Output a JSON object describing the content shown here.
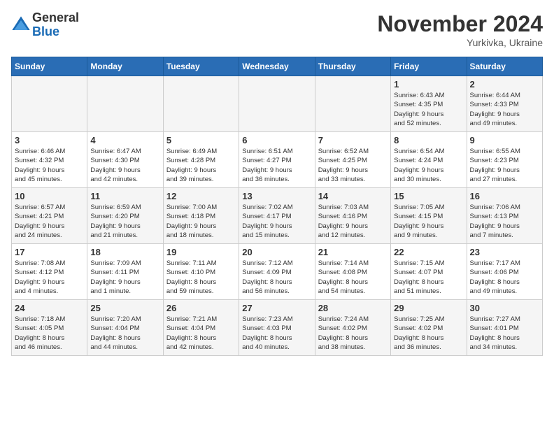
{
  "logo": {
    "general": "General",
    "blue": "Blue"
  },
  "title": "November 2024",
  "location": "Yurkivka, Ukraine",
  "days_of_week": [
    "Sunday",
    "Monday",
    "Tuesday",
    "Wednesday",
    "Thursday",
    "Friday",
    "Saturday"
  ],
  "weeks": [
    [
      {
        "day": "",
        "info": ""
      },
      {
        "day": "",
        "info": ""
      },
      {
        "day": "",
        "info": ""
      },
      {
        "day": "",
        "info": ""
      },
      {
        "day": "",
        "info": ""
      },
      {
        "day": "1",
        "info": "Sunrise: 6:43 AM\nSunset: 4:35 PM\nDaylight: 9 hours\nand 52 minutes."
      },
      {
        "day": "2",
        "info": "Sunrise: 6:44 AM\nSunset: 4:33 PM\nDaylight: 9 hours\nand 49 minutes."
      }
    ],
    [
      {
        "day": "3",
        "info": "Sunrise: 6:46 AM\nSunset: 4:32 PM\nDaylight: 9 hours\nand 45 minutes."
      },
      {
        "day": "4",
        "info": "Sunrise: 6:47 AM\nSunset: 4:30 PM\nDaylight: 9 hours\nand 42 minutes."
      },
      {
        "day": "5",
        "info": "Sunrise: 6:49 AM\nSunset: 4:28 PM\nDaylight: 9 hours\nand 39 minutes."
      },
      {
        "day": "6",
        "info": "Sunrise: 6:51 AM\nSunset: 4:27 PM\nDaylight: 9 hours\nand 36 minutes."
      },
      {
        "day": "7",
        "info": "Sunrise: 6:52 AM\nSunset: 4:25 PM\nDaylight: 9 hours\nand 33 minutes."
      },
      {
        "day": "8",
        "info": "Sunrise: 6:54 AM\nSunset: 4:24 PM\nDaylight: 9 hours\nand 30 minutes."
      },
      {
        "day": "9",
        "info": "Sunrise: 6:55 AM\nSunset: 4:23 PM\nDaylight: 9 hours\nand 27 minutes."
      }
    ],
    [
      {
        "day": "10",
        "info": "Sunrise: 6:57 AM\nSunset: 4:21 PM\nDaylight: 9 hours\nand 24 minutes."
      },
      {
        "day": "11",
        "info": "Sunrise: 6:59 AM\nSunset: 4:20 PM\nDaylight: 9 hours\nand 21 minutes."
      },
      {
        "day": "12",
        "info": "Sunrise: 7:00 AM\nSunset: 4:18 PM\nDaylight: 9 hours\nand 18 minutes."
      },
      {
        "day": "13",
        "info": "Sunrise: 7:02 AM\nSunset: 4:17 PM\nDaylight: 9 hours\nand 15 minutes."
      },
      {
        "day": "14",
        "info": "Sunrise: 7:03 AM\nSunset: 4:16 PM\nDaylight: 9 hours\nand 12 minutes."
      },
      {
        "day": "15",
        "info": "Sunrise: 7:05 AM\nSunset: 4:15 PM\nDaylight: 9 hours\nand 9 minutes."
      },
      {
        "day": "16",
        "info": "Sunrise: 7:06 AM\nSunset: 4:13 PM\nDaylight: 9 hours\nand 7 minutes."
      }
    ],
    [
      {
        "day": "17",
        "info": "Sunrise: 7:08 AM\nSunset: 4:12 PM\nDaylight: 9 hours\nand 4 minutes."
      },
      {
        "day": "18",
        "info": "Sunrise: 7:09 AM\nSunset: 4:11 PM\nDaylight: 9 hours\nand 1 minute."
      },
      {
        "day": "19",
        "info": "Sunrise: 7:11 AM\nSunset: 4:10 PM\nDaylight: 8 hours\nand 59 minutes."
      },
      {
        "day": "20",
        "info": "Sunrise: 7:12 AM\nSunset: 4:09 PM\nDaylight: 8 hours\nand 56 minutes."
      },
      {
        "day": "21",
        "info": "Sunrise: 7:14 AM\nSunset: 4:08 PM\nDaylight: 8 hours\nand 54 minutes."
      },
      {
        "day": "22",
        "info": "Sunrise: 7:15 AM\nSunset: 4:07 PM\nDaylight: 8 hours\nand 51 minutes."
      },
      {
        "day": "23",
        "info": "Sunrise: 7:17 AM\nSunset: 4:06 PM\nDaylight: 8 hours\nand 49 minutes."
      }
    ],
    [
      {
        "day": "24",
        "info": "Sunrise: 7:18 AM\nSunset: 4:05 PM\nDaylight: 8 hours\nand 46 minutes."
      },
      {
        "day": "25",
        "info": "Sunrise: 7:20 AM\nSunset: 4:04 PM\nDaylight: 8 hours\nand 44 minutes."
      },
      {
        "day": "26",
        "info": "Sunrise: 7:21 AM\nSunset: 4:04 PM\nDaylight: 8 hours\nand 42 minutes."
      },
      {
        "day": "27",
        "info": "Sunrise: 7:23 AM\nSunset: 4:03 PM\nDaylight: 8 hours\nand 40 minutes."
      },
      {
        "day": "28",
        "info": "Sunrise: 7:24 AM\nSunset: 4:02 PM\nDaylight: 8 hours\nand 38 minutes."
      },
      {
        "day": "29",
        "info": "Sunrise: 7:25 AM\nSunset: 4:02 PM\nDaylight: 8 hours\nand 36 minutes."
      },
      {
        "day": "30",
        "info": "Sunrise: 7:27 AM\nSunset: 4:01 PM\nDaylight: 8 hours\nand 34 minutes."
      }
    ]
  ]
}
